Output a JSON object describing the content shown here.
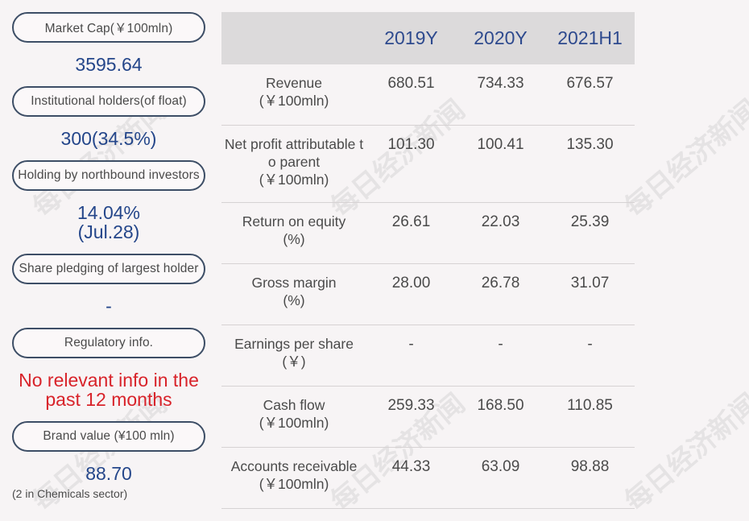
{
  "left_panel": {
    "market_cap": {
      "label": "Market Cap(￥100mln)",
      "value": "3595.64"
    },
    "institutional": {
      "label": "Institutional holders(of float)",
      "value": "300(34.5%)"
    },
    "northbound": {
      "label": "Holding by northbound investors",
      "value_line1": "14.04%",
      "value_line2": "(Jul.28)"
    },
    "pledging": {
      "label": "Share pledging of largest holder",
      "value": "-"
    },
    "regulatory": {
      "label": "Regulatory info.",
      "value_line1": "No relevant info in the",
      "value_line2": "past 12 months"
    },
    "brand": {
      "label": "Brand value (¥100 mln)",
      "value": "88.70",
      "note": "(2 in Chemicals sector)"
    }
  },
  "colors": {
    "value_blue": "#24468a",
    "alert_red": "#d8232a",
    "header_bg": "#dcdadb"
  },
  "table": {
    "columns": [
      "2019Y",
      "2020Y",
      "2021H1"
    ],
    "rows": [
      {
        "label1": "Revenue",
        "label2": "(￥100mln)",
        "label3": "",
        "values": [
          "680.51",
          "734.33",
          "676.57"
        ]
      },
      {
        "label1": "Net profit attributable t",
        "label2": "o parent",
        "label3": "(￥100mln)",
        "values": [
          "101.30",
          "100.41",
          "135.30"
        ]
      },
      {
        "label1": "Return on equity",
        "label2": "(%)",
        "label3": "",
        "values": [
          "26.61",
          "22.03",
          "25.39"
        ]
      },
      {
        "label1": "Gross margin",
        "label2": "(%)",
        "label3": "",
        "values": [
          "28.00",
          "26.78",
          "31.07"
        ]
      },
      {
        "label1": "Earnings per share",
        "label2": "(￥)",
        "label3": "",
        "values": [
          "-",
          "-",
          "-"
        ]
      },
      {
        "label1": "Cash flow",
        "label2": "(￥100mln)",
        "label3": "",
        "values": [
          "259.33",
          "168.50",
          "110.85"
        ]
      },
      {
        "label1": "Accounts receivable",
        "label2": "(￥100mln)",
        "label3": "",
        "values": [
          "44.33",
          "63.09",
          "98.88"
        ]
      }
    ]
  },
  "watermark_text": "每日经济新闻"
}
